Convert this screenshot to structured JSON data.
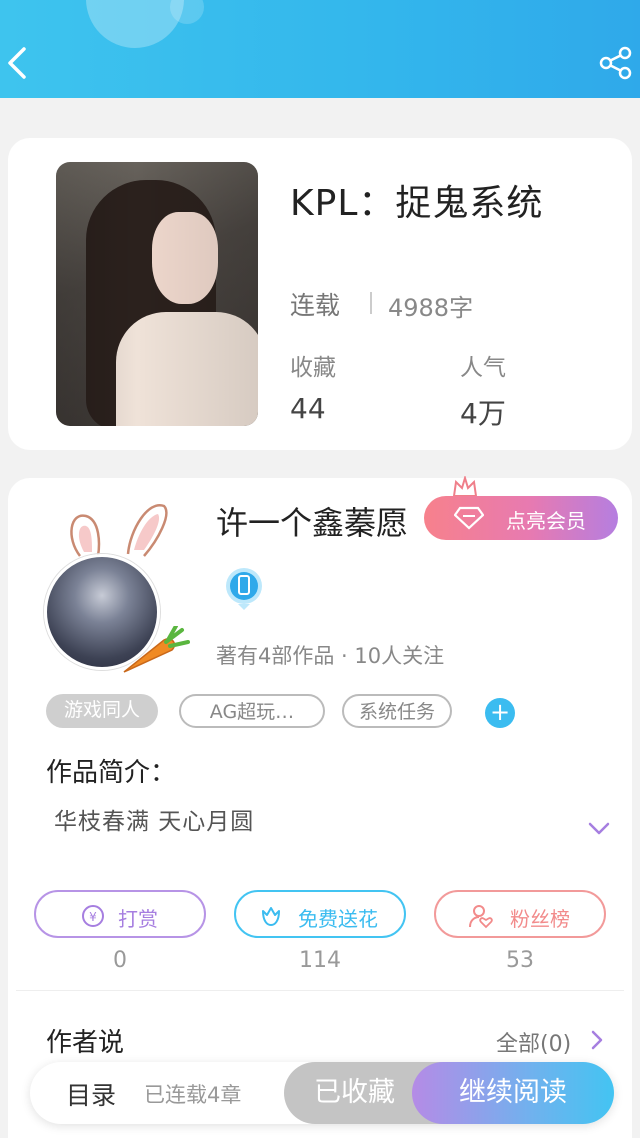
{
  "header": {
    "back_icon": "chevron-left-icon",
    "share_icon": "share-icon",
    "color": "#38b9ec"
  },
  "book": {
    "title": "KPL：捉鬼系统",
    "status": "连载",
    "word_count": "4988字",
    "favorites_label": "收藏",
    "favorites_value": "44",
    "popularity_label": "人气",
    "popularity_value": "4万"
  },
  "author": {
    "name": "许一个鑫蓁愿",
    "vip_button": "点亮会员",
    "meta": "著有4部作品 · 10人关注"
  },
  "tags": [
    "游戏同人",
    "AG超玩…",
    "系统任务"
  ],
  "intro": {
    "title": "作品简介：",
    "text": "华枝春满 天心月圆"
  },
  "actions": [
    {
      "label": "打赏",
      "count": "0",
      "color": "#a67ee0"
    },
    {
      "label": "免费送花",
      "count": "114",
      "color": "#3bbcf0"
    },
    {
      "label": "粉丝榜",
      "count": "53",
      "color": "#f28b8b"
    }
  ],
  "author_say": {
    "title": "作者说",
    "all": "全部(0)"
  },
  "bottom": {
    "toc": "目录",
    "chapters": "已连载4章",
    "favorited": "已收藏",
    "continue": "继续阅读"
  }
}
